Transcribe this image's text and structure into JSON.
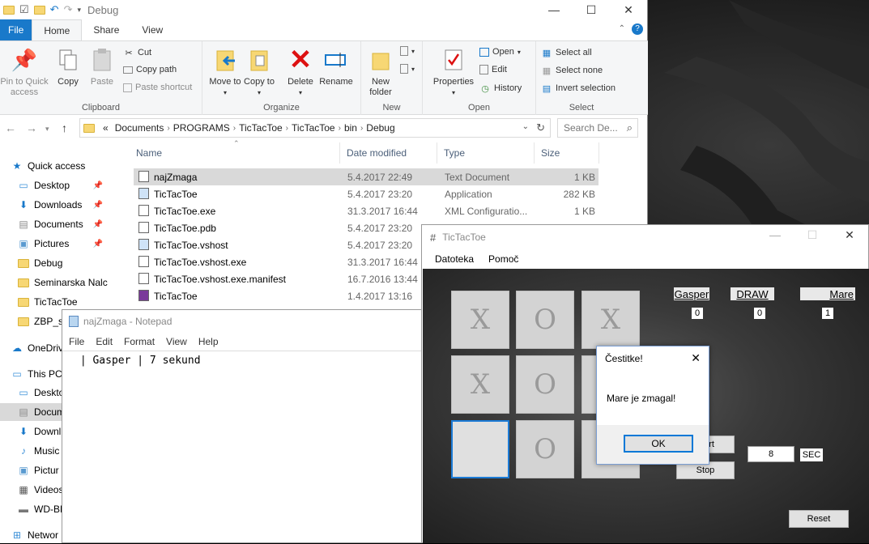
{
  "explorer": {
    "title": "Debug",
    "tabs": {
      "file": "File",
      "home": "Home",
      "share": "Share",
      "view": "View"
    },
    "ribbon": {
      "clipboard": {
        "label": "Clipboard",
        "pin": "Pin to Quick access",
        "copy": "Copy",
        "paste": "Paste",
        "cut": "Cut",
        "copy_path": "Copy path",
        "paste_shortcut": "Paste shortcut"
      },
      "organize": {
        "label": "Organize",
        "move_to": "Move to",
        "copy_to": "Copy to",
        "delete": "Delete",
        "rename": "Rename"
      },
      "new": {
        "label": "New",
        "new_folder": "New folder"
      },
      "open": {
        "label": "Open",
        "properties": "Properties",
        "open": "Open",
        "edit": "Edit",
        "history": "History"
      },
      "select": {
        "label": "Select",
        "select_all": "Select all",
        "select_none": "Select none",
        "invert": "Invert selection"
      }
    },
    "breadcrumb": [
      "«",
      "Documents",
      "PROGRAMS",
      "TicTacToe",
      "TicTacToe",
      "bin",
      "Debug"
    ],
    "search_placeholder": "Search De...",
    "columns": {
      "name": "Name",
      "date": "Date modified",
      "type": "Type",
      "size": "Size"
    },
    "nav": [
      {
        "label": "Quick access",
        "icon": "star-icon"
      },
      {
        "label": "Desktop",
        "icon": "desktop-icon",
        "pinned": true
      },
      {
        "label": "Downloads",
        "icon": "download-icon",
        "pinned": true
      },
      {
        "label": "Documents",
        "icon": "documents-icon",
        "pinned": true
      },
      {
        "label": "Pictures",
        "icon": "pictures-icon",
        "pinned": true
      },
      {
        "label": "Debug",
        "icon": "folder-icon"
      },
      {
        "label": "Seminarska Nalc",
        "icon": "folder-icon"
      },
      {
        "label": "TicTacToe",
        "icon": "folder-icon"
      },
      {
        "label": "ZBP_s",
        "icon": "folder-icon"
      },
      {
        "label": "OneDriv",
        "icon": "cloud-icon"
      },
      {
        "label": "This PC",
        "icon": "pc-icon"
      },
      {
        "label": "Deskto",
        "icon": "desktop-icon"
      },
      {
        "label": "Docum",
        "icon": "documents-icon"
      },
      {
        "label": "Downl",
        "icon": "download-icon"
      },
      {
        "label": "Music",
        "icon": "music-icon"
      },
      {
        "label": "Pictur",
        "icon": "pictures-icon"
      },
      {
        "label": "Videos",
        "icon": "videos-icon"
      },
      {
        "label": "WD-BL",
        "icon": "drive-icon"
      },
      {
        "label": "Networ",
        "icon": "network-icon"
      }
    ],
    "files": [
      {
        "name": "najZmaga",
        "date": "5.4.2017 22:49",
        "type": "Text Document",
        "size": "1 KB"
      },
      {
        "name": "TicTacToe",
        "date": "5.4.2017 23:20",
        "type": "Application",
        "size": "282 KB"
      },
      {
        "name": "TicTacToe.exe",
        "date": "31.3.2017 16:44",
        "type": "XML Configuratio...",
        "size": "1 KB"
      },
      {
        "name": "TicTacToe.pdb",
        "date": "5.4.2017 23:20",
        "type": "",
        "size": ""
      },
      {
        "name": "TicTacToe.vshost",
        "date": "5.4.2017 23:20",
        "type": "",
        "size": ""
      },
      {
        "name": "TicTacToe.vshost.exe",
        "date": "31.3.2017 16:44",
        "type": "",
        "size": ""
      },
      {
        "name": "TicTacToe.vshost.exe.manifest",
        "date": "16.7.2016 13:44",
        "type": "",
        "size": ""
      },
      {
        "name": "TicTacToe",
        "date": "1.4.2017 13:16",
        "type": "",
        "size": ""
      }
    ]
  },
  "notepad": {
    "title": "najZmaga - Notepad",
    "menu": [
      "File",
      "Edit",
      "Format",
      "View",
      "Help"
    ],
    "content": " | Gasper | 7 sekund"
  },
  "tictactoe": {
    "title": "TicTacToe",
    "menu": [
      "Datoteka",
      "Pomoč"
    ],
    "board": [
      "X",
      "O",
      "X",
      "X",
      "O",
      "",
      "",
      "O",
      ""
    ],
    "scores": [
      {
        "name": "Gasper",
        "value": "0"
      },
      {
        "name": "DRAW",
        "value": "0"
      },
      {
        "name": "Mare",
        "value": "1"
      }
    ],
    "start_label": "rt",
    "stop_label": "Stop",
    "timer_value": "8",
    "timer_unit": "SEC",
    "reset_label": "Reset"
  },
  "dialog": {
    "title": "Čestitke!",
    "message": "Mare je zmagal!",
    "ok": "OK"
  }
}
